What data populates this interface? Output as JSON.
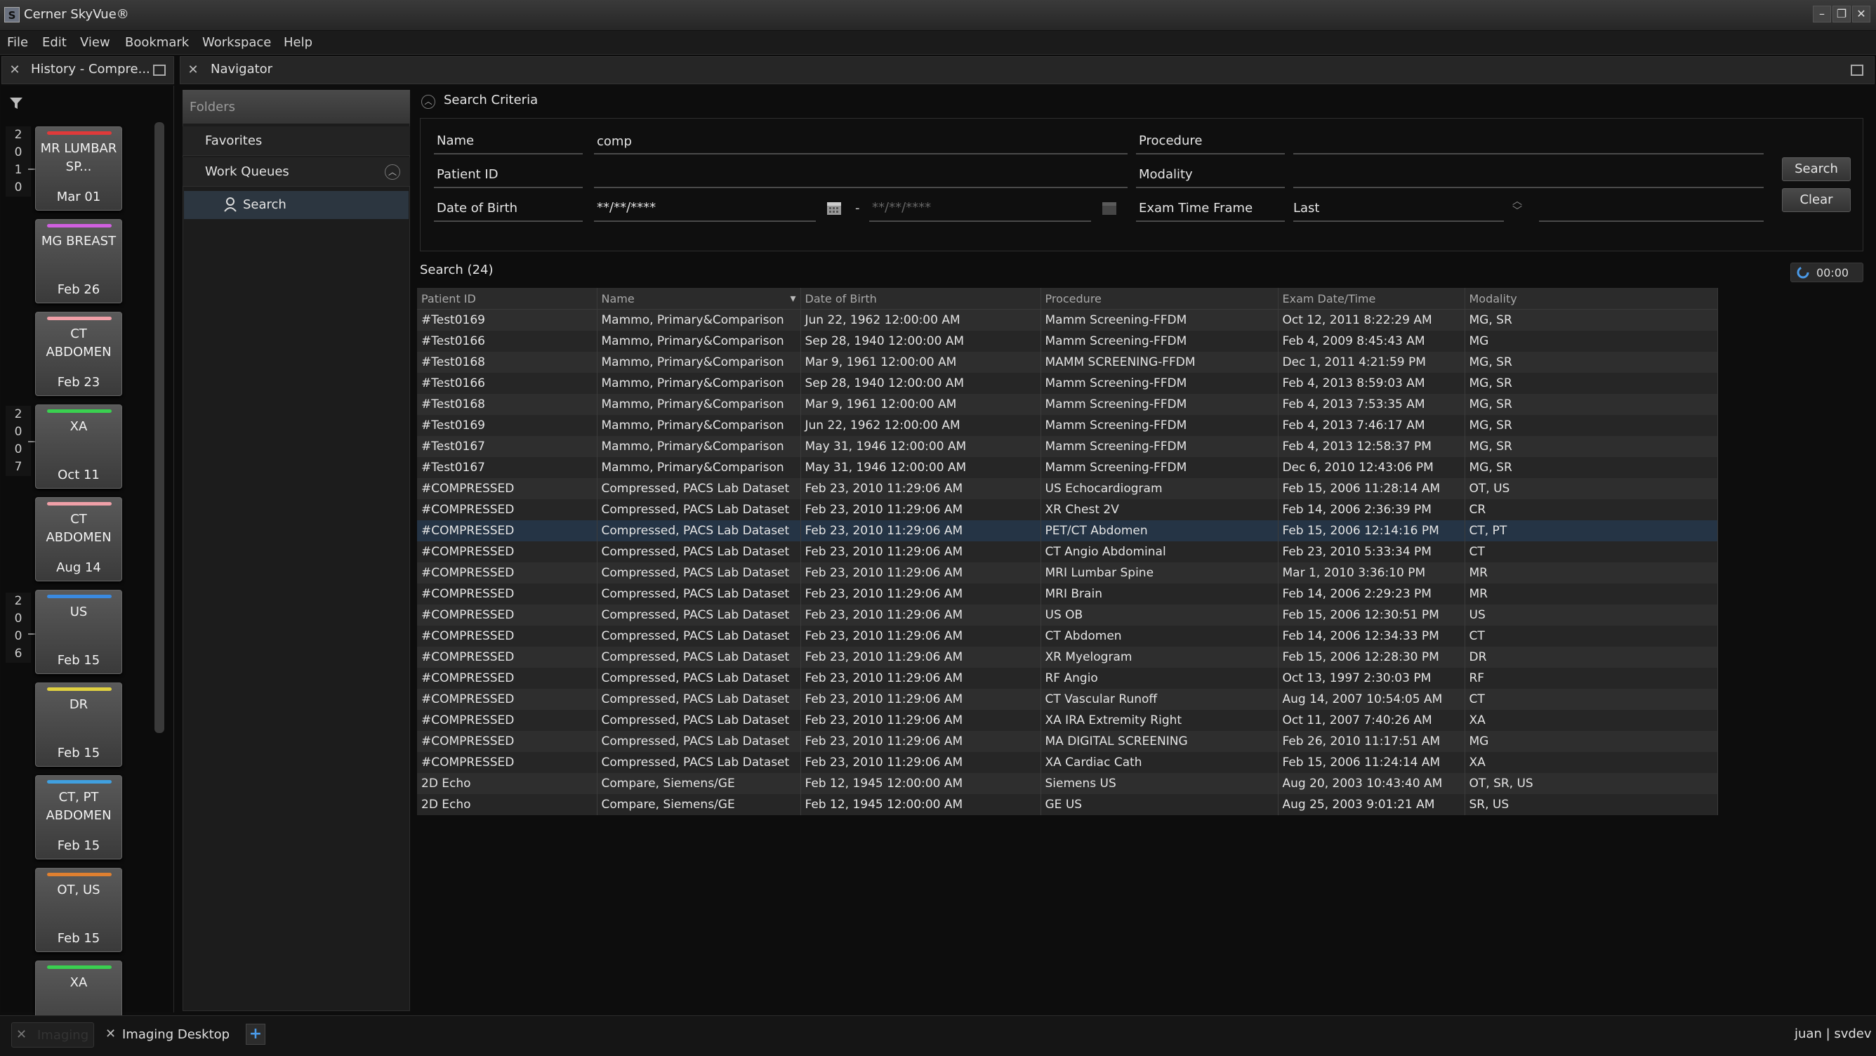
{
  "app": {
    "title": "Cerner SkyVue®"
  },
  "menu": [
    "File",
    "Edit",
    "View",
    "Bookmark",
    "Workspace",
    "Help"
  ],
  "history": {
    "title": "History - Compre...",
    "years": [
      "2010",
      "2007",
      "2006"
    ],
    "thumbnails": [
      {
        "modality": "MR LUMBAR SP...",
        "date": "Mar 01",
        "color": "#e03a3a"
      },
      {
        "modality": "MG BREAST",
        "date": "Feb 26",
        "color": "#d060e0"
      },
      {
        "modality": "CT ABDOMEN",
        "date": "Feb 23",
        "color": "#f0a0a8"
      },
      {
        "modality": "XA",
        "date": "Oct 11",
        "color": "#3ad050"
      },
      {
        "modality": "CT ABDOMEN",
        "date": "Aug 14",
        "color": "#f0a0a8"
      },
      {
        "modality": "US",
        "date": "Feb 15",
        "color": "#3a8ae0"
      },
      {
        "modality": "DR",
        "date": "Feb 15",
        "color": "#e0d040"
      },
      {
        "modality": "CT, PT ABDOMEN",
        "date": "Feb 15",
        "color": "#40a0e0"
      },
      {
        "modality": "OT, US",
        "date": "Feb 15",
        "color": "#e08030"
      },
      {
        "modality": "XA",
        "date": "",
        "color": "#3ad050"
      }
    ]
  },
  "navigator": {
    "title": "Navigator",
    "folders_title": "Folders",
    "favorites": "Favorites",
    "work_queues": "Work Queues",
    "search_item": "Search"
  },
  "criteria": {
    "title": "Search Criteria",
    "name_label": "Name",
    "name_value": "comp",
    "patient_id_label": "Patient ID",
    "dob_label": "Date of Birth",
    "dob_from": "**/**/****",
    "dob_to": "**/**/****",
    "procedure_label": "Procedure",
    "modality_label": "Modality",
    "exam_time_label": "Exam Time Frame",
    "exam_time_value": "Last",
    "search_button": "Search",
    "clear_button": "Clear"
  },
  "results": {
    "label": "Search (24)",
    "timer": "00:00",
    "columns": [
      "Patient ID",
      "Name",
      "Date of Birth",
      "Procedure",
      "Exam Date/Time",
      "Modality"
    ],
    "rows": [
      [
        "#Test0169",
        "Mammo, Primary&Comparison",
        "Jun 22, 1962 12:00:00 AM",
        "Mamm Screening-FFDM",
        "Oct 12, 2011 8:22:29 AM",
        "MG, SR"
      ],
      [
        "#Test0166",
        "Mammo, Primary&Comparison",
        "Sep 28, 1940 12:00:00 AM",
        "Mamm Screening-FFDM",
        "Feb 4, 2009 8:45:43 AM",
        "MG"
      ],
      [
        "#Test0168",
        "Mammo, Primary&Comparison",
        "Mar 9, 1961 12:00:00 AM",
        "MAMM SCREENING-FFDM",
        "Dec 1, 2011 4:21:59 PM",
        "MG, SR"
      ],
      [
        "#Test0166",
        "Mammo, Primary&Comparison",
        "Sep 28, 1940 12:00:00 AM",
        "Mamm Screening-FFDM",
        "Feb 4, 2013 8:59:03 AM",
        "MG, SR"
      ],
      [
        "#Test0168",
        "Mammo, Primary&Comparison",
        "Mar 9, 1961 12:00:00 AM",
        "Mamm Screening-FFDM",
        "Feb 4, 2013 7:53:35 AM",
        "MG, SR"
      ],
      [
        "#Test0169",
        "Mammo, Primary&Comparison",
        "Jun 22, 1962 12:00:00 AM",
        "Mamm Screening-FFDM",
        "Feb 4, 2013 7:46:17 AM",
        "MG, SR"
      ],
      [
        "#Test0167",
        "Mammo, Primary&Comparison",
        "May 31, 1946 12:00:00 AM",
        "Mamm Screening-FFDM",
        "Feb 4, 2013 12:58:37 PM",
        "MG, SR"
      ],
      [
        "#Test0167",
        "Mammo, Primary&Comparison",
        "May 31, 1946 12:00:00 AM",
        "Mamm Screening-FFDM",
        "Dec 6, 2010 12:43:06 PM",
        "MG, SR"
      ],
      [
        "#COMPRESSED",
        "Compressed, PACS Lab Dataset",
        "Feb 23, 2010 11:29:06 AM",
        "US Echocardiogram",
        "Feb 15, 2006 11:28:14 AM",
        "OT, US"
      ],
      [
        "#COMPRESSED",
        "Compressed, PACS Lab Dataset",
        "Feb 23, 2010 11:29:06 AM",
        "XR Chest 2V",
        "Feb 14, 2006 2:36:39 PM",
        "CR"
      ],
      [
        "#COMPRESSED",
        "Compressed, PACS Lab Dataset",
        "Feb 23, 2010 11:29:06 AM",
        "PET/CT Abdomen",
        "Feb 15, 2006 12:14:16 PM",
        "CT, PT"
      ],
      [
        "#COMPRESSED",
        "Compressed, PACS Lab Dataset",
        "Feb 23, 2010 11:29:06 AM",
        "CT Angio Abdominal",
        "Feb 23, 2010 5:33:34 PM",
        "CT"
      ],
      [
        "#COMPRESSED",
        "Compressed, PACS Lab Dataset",
        "Feb 23, 2010 11:29:06 AM",
        "MRI Lumbar Spine",
        "Mar 1, 2010 3:36:10 PM",
        "MR"
      ],
      [
        "#COMPRESSED",
        "Compressed, PACS Lab Dataset",
        "Feb 23, 2010 11:29:06 AM",
        "MRI Brain",
        "Feb 14, 2006 2:29:23 PM",
        "MR"
      ],
      [
        "#COMPRESSED",
        "Compressed, PACS Lab Dataset",
        "Feb 23, 2010 11:29:06 AM",
        "US OB",
        "Feb 15, 2006 12:30:51 PM",
        "US"
      ],
      [
        "#COMPRESSED",
        "Compressed, PACS Lab Dataset",
        "Feb 23, 2010 11:29:06 AM",
        "CT Abdomen",
        "Feb 14, 2006 12:34:33 PM",
        "CT"
      ],
      [
        "#COMPRESSED",
        "Compressed, PACS Lab Dataset",
        "Feb 23, 2010 11:29:06 AM",
        "XR Myelogram",
        "Feb 15, 2006 12:28:30 PM",
        "DR"
      ],
      [
        "#COMPRESSED",
        "Compressed, PACS Lab Dataset",
        "Feb 23, 2010 11:29:06 AM",
        "RF Angio",
        "Oct 13, 1997 2:30:03 PM",
        "RF"
      ],
      [
        "#COMPRESSED",
        "Compressed, PACS Lab Dataset",
        "Feb 23, 2010 11:29:06 AM",
        "CT Vascular Runoff",
        "Aug 14, 2007 10:54:05 AM",
        "CT"
      ],
      [
        "#COMPRESSED",
        "Compressed, PACS Lab Dataset",
        "Feb 23, 2010 11:29:06 AM",
        "XA IRA Extremity Right",
        "Oct 11, 2007 7:40:26 AM",
        "XA"
      ],
      [
        "#COMPRESSED",
        "Compressed, PACS Lab Dataset",
        "Feb 23, 2010 11:29:06 AM",
        "MA DIGITAL SCREENING",
        "Feb 26, 2010 11:17:51 AM",
        "MG"
      ],
      [
        "#COMPRESSED",
        "Compressed, PACS Lab Dataset",
        "Feb 23, 2010 11:29:06 AM",
        "XA Cardiac Cath",
        "Feb 15, 2006 11:24:14 AM",
        "XA"
      ],
      [
        "2D Echo",
        "Compare, Siemens/GE",
        "Feb 12, 1945 12:00:00 AM",
        "Siemens US",
        "Aug 20, 2003 10:43:40 AM",
        "OT, SR, US"
      ],
      [
        "2D Echo",
        "Compare, Siemens/GE",
        "Feb 12, 1945 12:00:00 AM",
        "GE US",
        "Aug 25, 2003 9:01:21 AM",
        "SR, US"
      ]
    ],
    "selected_row": 10
  },
  "bottom": {
    "tab_imaging": "Imaging",
    "tab_desktop": "Imaging Desktop",
    "user": "juan | svdev"
  }
}
